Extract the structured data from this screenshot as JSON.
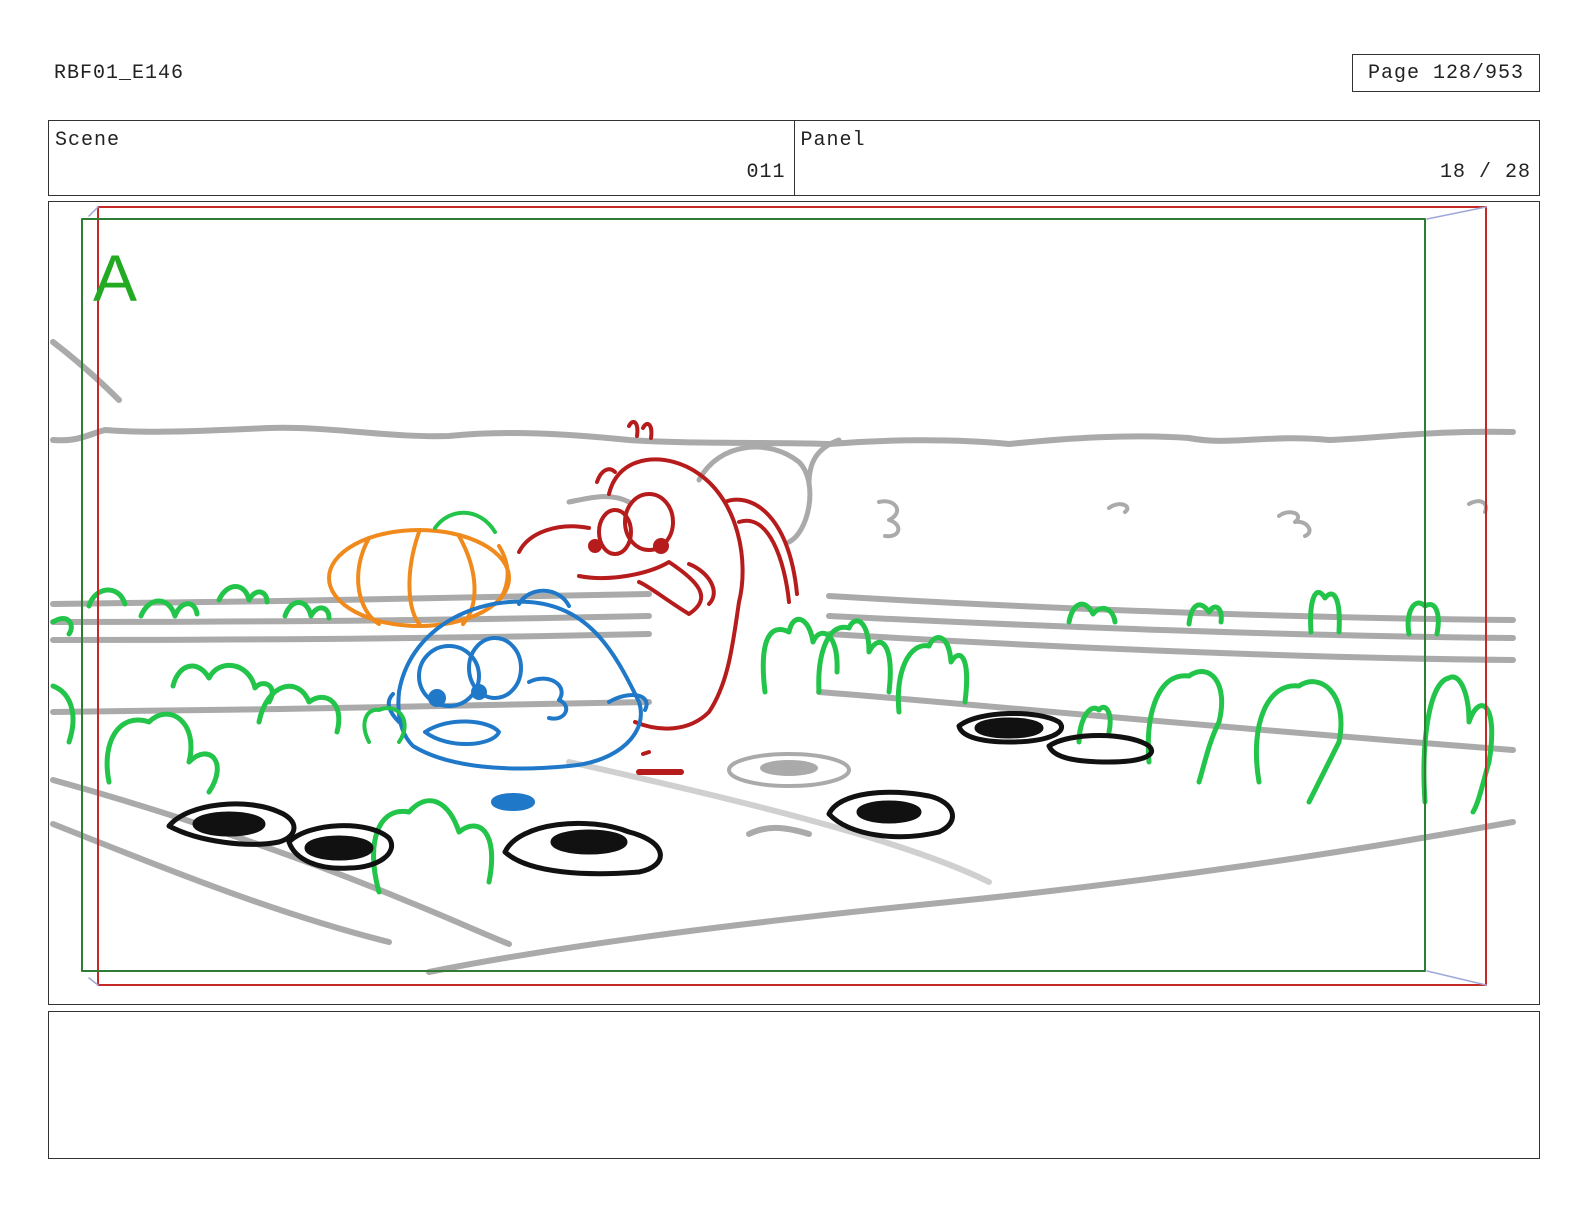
{
  "header": {
    "doc_id": "RBF01_E146",
    "page_label": "Page 128/953"
  },
  "info": {
    "scene_label": "Scene",
    "scene_value": "011",
    "panel_label": "Panel",
    "panel_value": "18 / 28"
  },
  "frame": {
    "panel_letter": "A",
    "colors": {
      "safe_area": "#2e7d32",
      "action_area": "#c62828",
      "background_sketch": "#aaaaaa",
      "plants": "#22c44a",
      "character_red": "#b71c1c",
      "character_blue": "#1f78c8",
      "pumpkin": "#f08a1c",
      "holes": "#111111"
    }
  },
  "notes": {
    "text": ""
  }
}
